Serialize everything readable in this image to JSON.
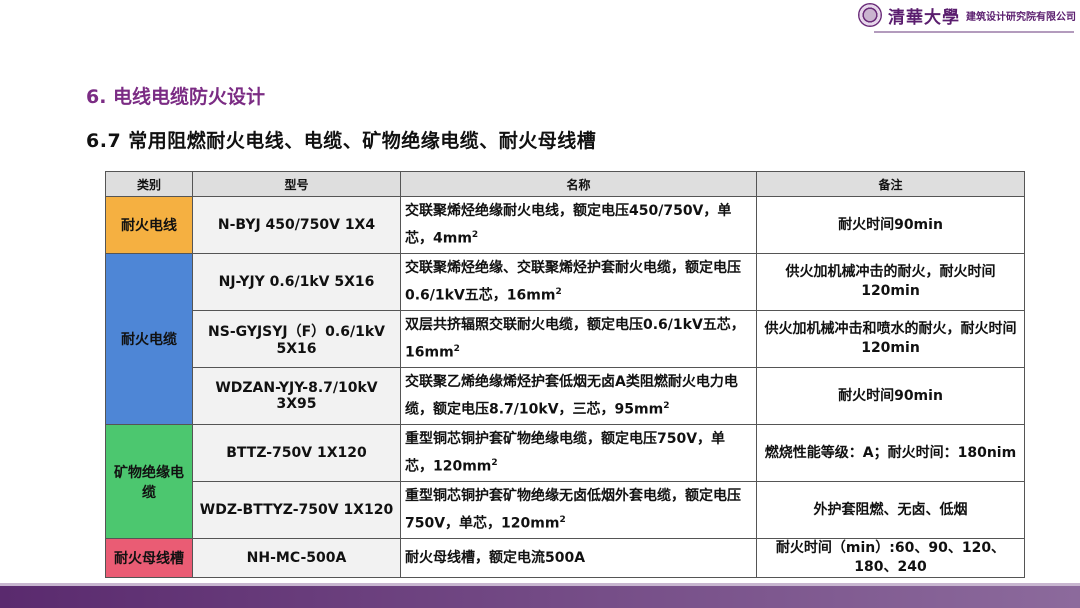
{
  "header": {
    "logo_cn": "清華大學",
    "logo_org": "建筑设计研究院有限公司"
  },
  "section_title": "6. 电线电缆防火设计",
  "sub_title": "6.7 常用阻燃耐火电线、电缆、矿物绝缘电缆、耐火母线槽",
  "table": {
    "headers": [
      "类别",
      "型号",
      "名称",
      "备注"
    ],
    "categories": {
      "wire": "耐火电线",
      "cable": "耐火电缆",
      "mineral": "矿物绝缘电缆",
      "busway": "耐火母线槽"
    },
    "rows": [
      {
        "model": "N-BYJ 450/750V 1X4",
        "name_pre": "交联聚烯烃绝缘耐火电线，额定电压450/750V，单芯，4mm",
        "name_post": "",
        "note": "耐火时间90min"
      },
      {
        "model": "NJ-YJY 0.6/1kV 5X16",
        "name_pre": "交联聚烯烃绝缘、交联聚烯烃护套耐火电缆，额定电压0.6/1kV五芯，16mm",
        "name_post": "",
        "note": "供火加机械冲击的耐火，耐火时间120min"
      },
      {
        "model": "NS-GYJSYJ（F）0.6/1kV 5X16",
        "name_pre": "双层共挤辐照交联耐火电缆，额定电压0.6/1kV五芯，16mm",
        "name_post": "",
        "note": "供火加机械冲击和喷水的耐火，耐火时间120min"
      },
      {
        "model": "WDZAN-YJY-8.7/10kV 3X95",
        "name_pre": "交联聚乙烯绝缘烯烃护套低烟无卤A类阻燃耐火电力电缆，额定电压8.7/10kV，三芯，95mm",
        "name_post": "",
        "note": "耐火时间90min"
      },
      {
        "model": "BTTZ-750V 1X120",
        "name_pre": "重型铜芯铜护套矿物绝缘电缆，额定电压750V，单芯，120mm",
        "name_post": "",
        "note": "燃烧性能等级：A；耐火时间：180nim"
      },
      {
        "model": "WDZ-BTTYZ-750V 1X120",
        "name_pre": "重型铜芯铜护套矿物绝缘无卤低烟外套电缆，额定电压750V，单芯，120mm",
        "name_post": "",
        "note": "外护套阻燃、无卤、低烟"
      },
      {
        "model": "NH-MC-500A",
        "name_pre": "耐火母线槽，额定电流500A",
        "name_post": "",
        "note": "耐火时间（min）:60、90、120、180、240"
      }
    ],
    "superscript": "2"
  }
}
